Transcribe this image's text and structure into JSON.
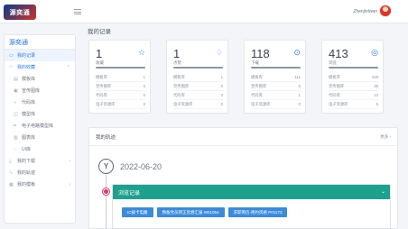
{
  "header": {
    "logo_text": "源奕通",
    "username": "Zhenjinlwan"
  },
  "sidebar": {
    "title": "源奕通",
    "items": [
      {
        "label": "我的记录",
        "icon": "record-icon",
        "glyph": "▭",
        "active": true
      },
      {
        "label": "我的收藏",
        "icon": "heart-icon",
        "glyph": "♡",
        "group": true,
        "chevron": "⌃"
      },
      {
        "label": "模板库",
        "icon": "template-icon",
        "glyph": "▤",
        "sub": true
      },
      {
        "label": "宣传图库",
        "icon": "image-icon",
        "glyph": "▣",
        "sub": true
      },
      {
        "label": "代码库",
        "icon": "code-icon",
        "glyph": "‹›",
        "sub": true
      },
      {
        "label": "模型库",
        "icon": "model-icon",
        "glyph": "◫",
        "sub": true
      },
      {
        "label": "电子电路模型库",
        "icon": "circuit-icon",
        "glyph": "⌗",
        "sub": true
      },
      {
        "label": "图表库",
        "icon": "chart-icon",
        "glyph": "▥",
        "sub": true
      },
      {
        "label": "UI库",
        "icon": "ui-icon",
        "glyph": "◌",
        "sub": true
      },
      {
        "label": "我的下载",
        "icon": "download-icon",
        "glyph": "⤓",
        "chevron": "›"
      },
      {
        "label": "我的轨迹",
        "icon": "track-icon",
        "glyph": "∿"
      },
      {
        "label": "我的模板",
        "icon": "template-icon",
        "glyph": "▦",
        "chevron": "›"
      }
    ]
  },
  "page_title": "我的记录",
  "stats": [
    {
      "value": "1",
      "label": "收藏",
      "icon": "star-icon",
      "glyph": "☆",
      "rows": [
        [
          "模板库",
          "1"
        ],
        [
          "宣传图库",
          "0"
        ],
        [
          "代码库",
          "0"
        ],
        [
          "电子资源库",
          "0"
        ]
      ]
    },
    {
      "value": "1",
      "label": "点赞",
      "icon": "thumb-up-icon",
      "glyph": "♢",
      "rows": [
        [
          "模板库",
          "1"
        ],
        [
          "宣传图库",
          "0"
        ],
        [
          "代码库",
          "0"
        ],
        [
          "电子资源库",
          "0"
        ]
      ]
    },
    {
      "value": "118",
      "label": "下载",
      "icon": "download-circle-icon",
      "glyph": "⊙",
      "rows": [
        [
          "模板库",
          "111"
        ],
        [
          "宣传图库",
          "6"
        ],
        [
          "代码库",
          "1"
        ],
        [
          "电子资源库",
          "0"
        ]
      ]
    },
    {
      "value": "413",
      "label": "浏览",
      "icon": "eye-icon",
      "glyph": "◎",
      "rows": [
        [
          "模板库",
          "319"
        ],
        [
          "宣传图库",
          "36"
        ],
        [
          "代码库",
          "13"
        ],
        [
          "电子资源库",
          "5"
        ]
      ]
    }
  ],
  "track": {
    "title": "我的轨迹",
    "more": "更多 ›",
    "date": "2022-06-20",
    "circle_glyph": "Y",
    "record_title": "浏览记录",
    "record_chevron": "⌄",
    "tags": [
      "IC拨卡电路",
      "预备党员转正思想汇报 W01054",
      "求职简历-简约风格 P01173"
    ]
  }
}
